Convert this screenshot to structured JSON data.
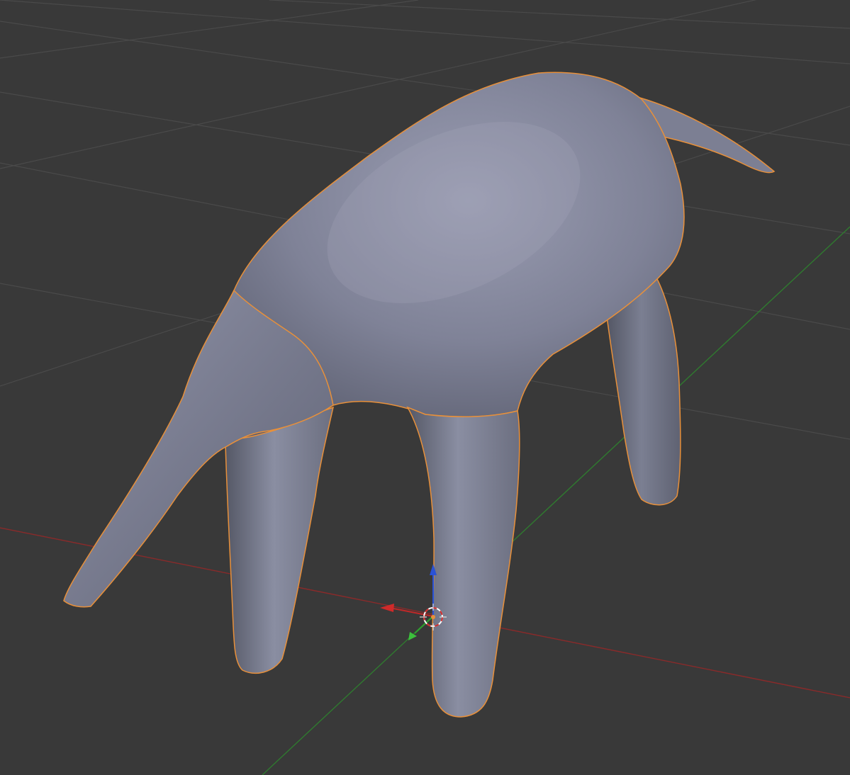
{
  "viewport": {
    "background_color": "#393939",
    "grid_color": "#4a4a4a",
    "x_axis_color": "#8a2a2a",
    "y_axis_color": "#2f7a2f",
    "z_axis_color": "#2a52d6",
    "selection_outline_color": "#e8903a",
    "mesh_base_color": "#8a8ea6",
    "mesh_shadow_color": "#575a6c"
  },
  "scene": {
    "object": "sculpted-quadruped-mesh",
    "selected": true
  },
  "gizmo": {
    "icon": "3d-cursor-icon",
    "x_arrow_icon": "x-axis-arrow-icon",
    "y_arrow_icon": "y-axis-arrow-icon",
    "z_arrow_icon": "z-axis-arrow-icon"
  }
}
